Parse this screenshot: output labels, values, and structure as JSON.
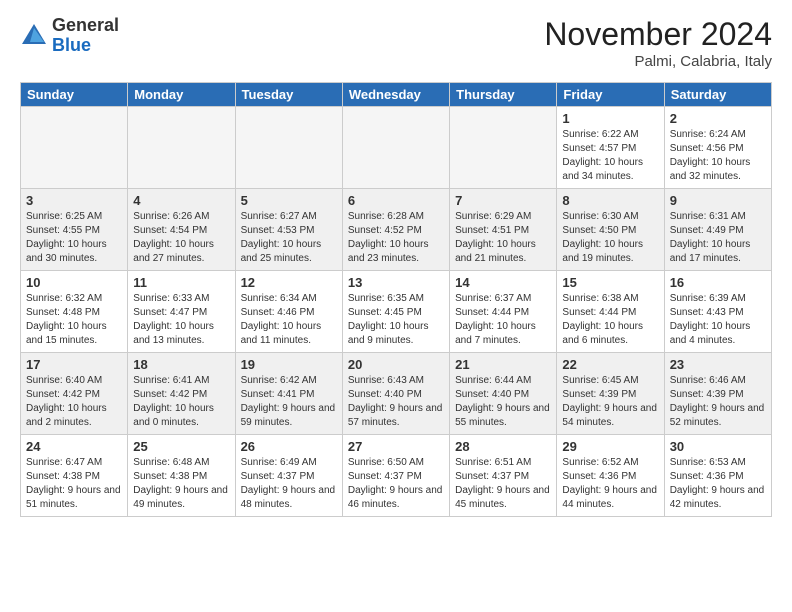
{
  "header": {
    "logo_general": "General",
    "logo_blue": "Blue",
    "month_title": "November 2024",
    "location": "Palmi, Calabria, Italy"
  },
  "days_of_week": [
    "Sunday",
    "Monday",
    "Tuesday",
    "Wednesday",
    "Thursday",
    "Friday",
    "Saturday"
  ],
  "weeks": [
    [
      {
        "day": "",
        "info": ""
      },
      {
        "day": "",
        "info": ""
      },
      {
        "day": "",
        "info": ""
      },
      {
        "day": "",
        "info": ""
      },
      {
        "day": "",
        "info": ""
      },
      {
        "day": "1",
        "info": "Sunrise: 6:22 AM\nSunset: 4:57 PM\nDaylight: 10 hours and 34 minutes."
      },
      {
        "day": "2",
        "info": "Sunrise: 6:24 AM\nSunset: 4:56 PM\nDaylight: 10 hours and 32 minutes."
      }
    ],
    [
      {
        "day": "3",
        "info": "Sunrise: 6:25 AM\nSunset: 4:55 PM\nDaylight: 10 hours and 30 minutes."
      },
      {
        "day": "4",
        "info": "Sunrise: 6:26 AM\nSunset: 4:54 PM\nDaylight: 10 hours and 27 minutes."
      },
      {
        "day": "5",
        "info": "Sunrise: 6:27 AM\nSunset: 4:53 PM\nDaylight: 10 hours and 25 minutes."
      },
      {
        "day": "6",
        "info": "Sunrise: 6:28 AM\nSunset: 4:52 PM\nDaylight: 10 hours and 23 minutes."
      },
      {
        "day": "7",
        "info": "Sunrise: 6:29 AM\nSunset: 4:51 PM\nDaylight: 10 hours and 21 minutes."
      },
      {
        "day": "8",
        "info": "Sunrise: 6:30 AM\nSunset: 4:50 PM\nDaylight: 10 hours and 19 minutes."
      },
      {
        "day": "9",
        "info": "Sunrise: 6:31 AM\nSunset: 4:49 PM\nDaylight: 10 hours and 17 minutes."
      }
    ],
    [
      {
        "day": "10",
        "info": "Sunrise: 6:32 AM\nSunset: 4:48 PM\nDaylight: 10 hours and 15 minutes."
      },
      {
        "day": "11",
        "info": "Sunrise: 6:33 AM\nSunset: 4:47 PM\nDaylight: 10 hours and 13 minutes."
      },
      {
        "day": "12",
        "info": "Sunrise: 6:34 AM\nSunset: 4:46 PM\nDaylight: 10 hours and 11 minutes."
      },
      {
        "day": "13",
        "info": "Sunrise: 6:35 AM\nSunset: 4:45 PM\nDaylight: 10 hours and 9 minutes."
      },
      {
        "day": "14",
        "info": "Sunrise: 6:37 AM\nSunset: 4:44 PM\nDaylight: 10 hours and 7 minutes."
      },
      {
        "day": "15",
        "info": "Sunrise: 6:38 AM\nSunset: 4:44 PM\nDaylight: 10 hours and 6 minutes."
      },
      {
        "day": "16",
        "info": "Sunrise: 6:39 AM\nSunset: 4:43 PM\nDaylight: 10 hours and 4 minutes."
      }
    ],
    [
      {
        "day": "17",
        "info": "Sunrise: 6:40 AM\nSunset: 4:42 PM\nDaylight: 10 hours and 2 minutes."
      },
      {
        "day": "18",
        "info": "Sunrise: 6:41 AM\nSunset: 4:42 PM\nDaylight: 10 hours and 0 minutes."
      },
      {
        "day": "19",
        "info": "Sunrise: 6:42 AM\nSunset: 4:41 PM\nDaylight: 9 hours and 59 minutes."
      },
      {
        "day": "20",
        "info": "Sunrise: 6:43 AM\nSunset: 4:40 PM\nDaylight: 9 hours and 57 minutes."
      },
      {
        "day": "21",
        "info": "Sunrise: 6:44 AM\nSunset: 4:40 PM\nDaylight: 9 hours and 55 minutes."
      },
      {
        "day": "22",
        "info": "Sunrise: 6:45 AM\nSunset: 4:39 PM\nDaylight: 9 hours and 54 minutes."
      },
      {
        "day": "23",
        "info": "Sunrise: 6:46 AM\nSunset: 4:39 PM\nDaylight: 9 hours and 52 minutes."
      }
    ],
    [
      {
        "day": "24",
        "info": "Sunrise: 6:47 AM\nSunset: 4:38 PM\nDaylight: 9 hours and 51 minutes."
      },
      {
        "day": "25",
        "info": "Sunrise: 6:48 AM\nSunset: 4:38 PM\nDaylight: 9 hours and 49 minutes."
      },
      {
        "day": "26",
        "info": "Sunrise: 6:49 AM\nSunset: 4:37 PM\nDaylight: 9 hours and 48 minutes."
      },
      {
        "day": "27",
        "info": "Sunrise: 6:50 AM\nSunset: 4:37 PM\nDaylight: 9 hours and 46 minutes."
      },
      {
        "day": "28",
        "info": "Sunrise: 6:51 AM\nSunset: 4:37 PM\nDaylight: 9 hours and 45 minutes."
      },
      {
        "day": "29",
        "info": "Sunrise: 6:52 AM\nSunset: 4:36 PM\nDaylight: 9 hours and 44 minutes."
      },
      {
        "day": "30",
        "info": "Sunrise: 6:53 AM\nSunset: 4:36 PM\nDaylight: 9 hours and 42 minutes."
      }
    ]
  ]
}
